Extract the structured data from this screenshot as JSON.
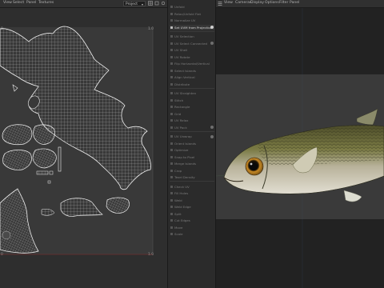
{
  "uv_editor": {
    "menu": [
      "View",
      "Select",
      "Panel",
      "Textures"
    ],
    "dropdown_value": "Project",
    "ruler": {
      "top_left": "0",
      "top_right": "1.0",
      "bottom_left": "0",
      "bottom_right": "1.0"
    }
  },
  "tools": [
    {
      "label": "Unfold",
      "active": false
    },
    {
      "label": "Relax/Unfold Flat",
      "active": false
    },
    {
      "label": "Normalize UV",
      "active": false
    },
    {
      "label": "Set UVM from Projection",
      "active": true,
      "dot": true
    },
    {
      "label": "UV Selection",
      "active": false
    },
    {
      "label": "UV Select Connected",
      "active": false,
      "dot": true
    },
    {
      "label": "UV Shell",
      "active": false
    },
    {
      "label": "UV Rotate",
      "active": false
    },
    {
      "label": "Flip Horizontal/Vertical",
      "active": false
    },
    {
      "label": "Select Islands",
      "active": false
    },
    {
      "label": "Align Vertical",
      "active": false
    },
    {
      "label": "Distribute",
      "active": false
    },
    {
      "label": "UV Straighten",
      "active": false
    },
    {
      "label": "Stitch",
      "active": false
    },
    {
      "label": "Rectangle",
      "active": false
    },
    {
      "label": "Grid",
      "active": false
    },
    {
      "label": "UV Relax",
      "active": false
    },
    {
      "label": "UV Pack",
      "active": false,
      "dot": true
    },
    {
      "label": "UV Unwrap",
      "active": false,
      "dot": true
    },
    {
      "label": "Orient Islands",
      "active": false
    },
    {
      "label": "Optimize",
      "active": false
    },
    {
      "label": "Snap to Pixel",
      "active": false
    },
    {
      "label": "Merge Islands",
      "active": false
    },
    {
      "label": "Crop",
      "active": false
    },
    {
      "label": "Texel Density",
      "active": false
    },
    {
      "label": "Check UV",
      "active": false
    },
    {
      "label": "Fill Holes",
      "active": false
    },
    {
      "label": "Weld",
      "active": false
    },
    {
      "label": "Weld Edge",
      "active": false
    },
    {
      "label": "Split",
      "active": false
    },
    {
      "label": "Cut Edges",
      "active": false
    },
    {
      "label": "Move",
      "active": false
    },
    {
      "label": "Scale",
      "active": false
    }
  ],
  "viewport": {
    "menu": [
      "View",
      "Cameras",
      "Display",
      "Options",
      "Filter",
      "Panel"
    ]
  },
  "colors": {
    "accent": "#d0d0d0",
    "uv_wire": "#e6e6e6",
    "uv_background": "#393939",
    "fish_back": "#6a6a32",
    "fish_belly": "#d9d6c8"
  }
}
